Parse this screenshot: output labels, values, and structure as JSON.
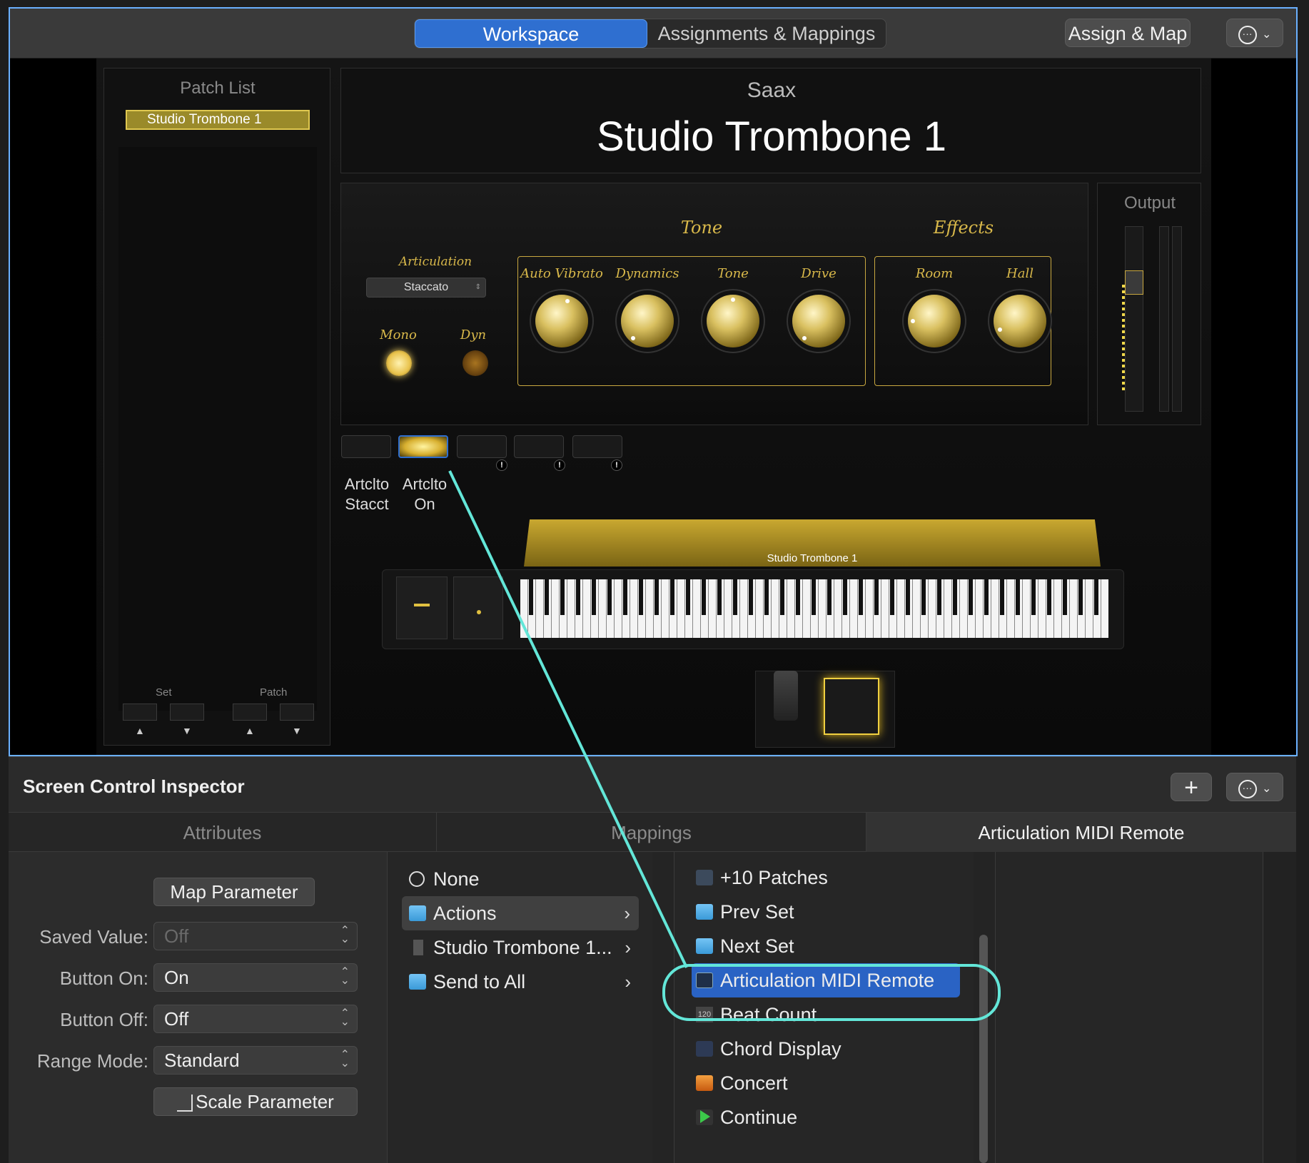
{
  "toolbar": {
    "segments": [
      "Workspace",
      "Assignments & Mappings"
    ],
    "active_segment": "Workspace",
    "assign_map_label": "Assign & Map",
    "more_icon": "ellipsis-circle-icon"
  },
  "patch_list": {
    "title": "Patch List",
    "items": [
      "Studio Trombone 1"
    ],
    "selected": "Studio Trombone 1",
    "set_label": "Set",
    "patch_label": "Patch",
    "up_arrow": "▲",
    "down_arrow": "▼"
  },
  "header": {
    "set_name": "Saax",
    "patch_name": "Studio Trombone 1"
  },
  "plugin": {
    "articulation_label": "Articulation",
    "articulation_value": "Staccato",
    "mono_label": "Mono",
    "dyn_label": "Dyn",
    "tone_group": "Tone",
    "effects_group": "Effects",
    "knobs": [
      "Auto Vibrato",
      "Dynamics",
      "Tone",
      "Drive"
    ],
    "effect_knobs": [
      "Room",
      "Hall"
    ],
    "output_label": "Output",
    "keyboard_label": "Studio Trombone 1",
    "accent_color": "#d8b84a"
  },
  "art_buttons": {
    "b1_line1": "Artclto",
    "b1_line2": "Stacct",
    "b2_line1": "Artclto",
    "b2_line2": "On",
    "warn_mark": "!"
  },
  "inspector": {
    "title": "Screen Control Inspector",
    "add_label": "+",
    "tabs": [
      "Attributes",
      "Mappings",
      "Articulation MIDI Remote"
    ],
    "active_tab": "Articulation MIDI Remote"
  },
  "attributes": {
    "map_parameter": "Map Parameter",
    "saved_value_label": "Saved Value:",
    "saved_value": "Off",
    "button_on_label": "Button On:",
    "button_on": "On",
    "button_off_label": "Button Off:",
    "button_off": "Off",
    "range_mode_label": "Range Mode:",
    "range_mode": "Standard",
    "scale_parameter": "Scale Parameter"
  },
  "menu1": {
    "none": "None",
    "actions": "Actions",
    "studio_trombone": "Studio Trombone 1...",
    "send_to_all": "Send to All",
    "chevron": "›"
  },
  "menu2": {
    "items": [
      "+10 Patches",
      "Prev Set",
      "Next Set",
      "Articulation MIDI Remote",
      "Beat Count",
      "Chord Display",
      "Concert",
      "Continue"
    ],
    "selected": "Articulation MIDI Remote",
    "beat_count_badge": "120"
  },
  "highlight_color": "#63e6d8"
}
